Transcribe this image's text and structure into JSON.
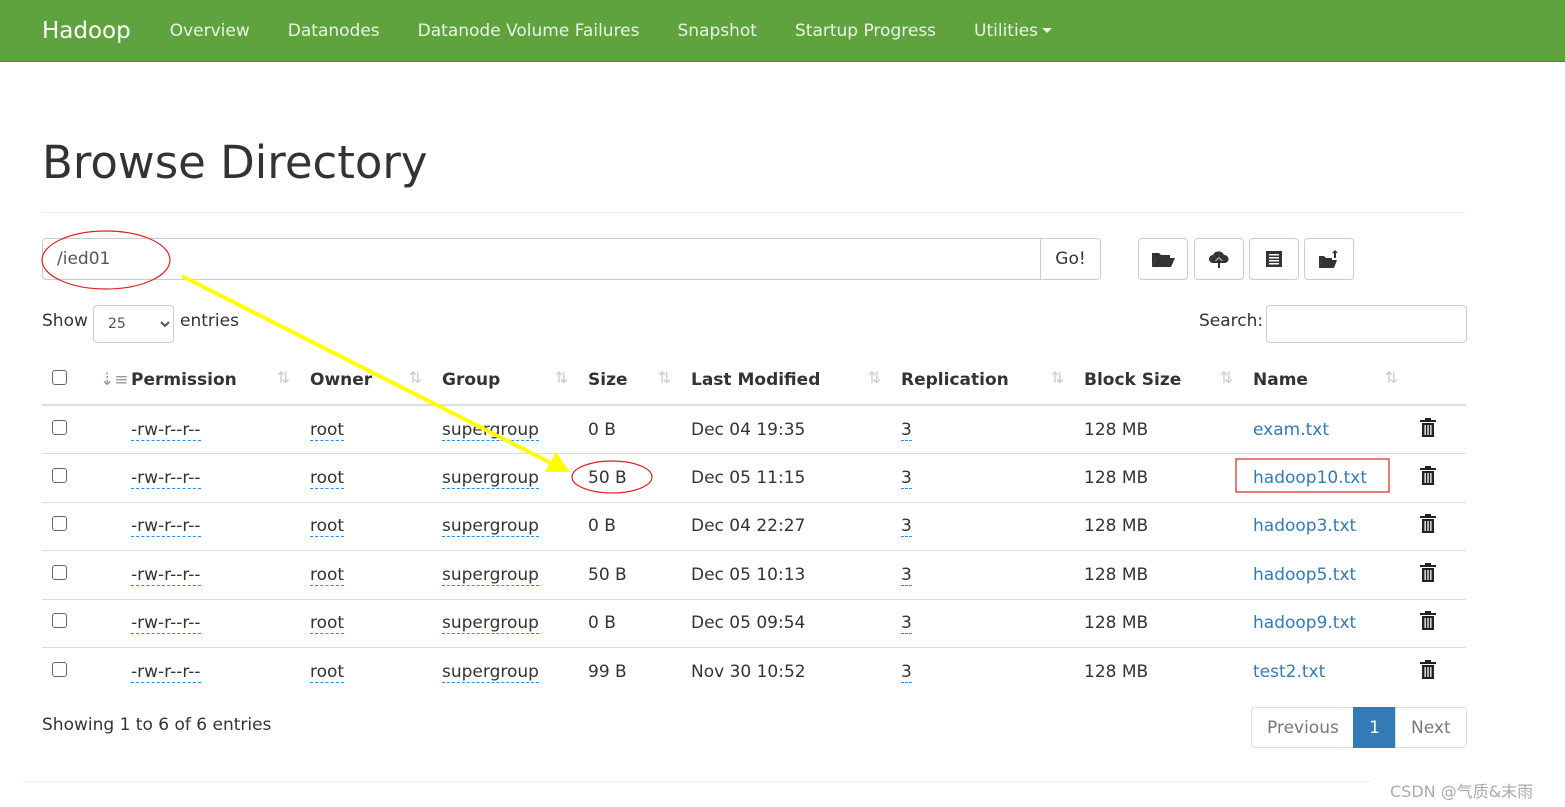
{
  "nav": {
    "brand": "Hadoop",
    "items": [
      "Overview",
      "Datanodes",
      "Datanode Volume Failures",
      "Snapshot",
      "Startup Progress",
      "Utilities"
    ]
  },
  "title": "Browse Directory",
  "path": {
    "value": "/ied01",
    "go": "Go!"
  },
  "toolbar_icons": [
    "folder-open-icon",
    "cloud-upload-icon",
    "list-icon",
    "folder-up-icon"
  ],
  "show": {
    "label": "Show",
    "value": "25",
    "suffix": "entries"
  },
  "search": {
    "label": "Search:",
    "value": ""
  },
  "columns": [
    "Permission",
    "Owner",
    "Group",
    "Size",
    "Last Modified",
    "Replication",
    "Block Size",
    "Name"
  ],
  "rows": [
    {
      "permission": "-rw-r--r--",
      "owner": "root",
      "group": "supergroup",
      "size": "0 B",
      "modified": "Dec 04 19:35",
      "replication": "3",
      "block": "128 MB",
      "name": "exam.txt"
    },
    {
      "permission": "-rw-r--r--",
      "owner": "root",
      "group": "supergroup",
      "size": "50 B",
      "modified": "Dec 05 11:15",
      "replication": "3",
      "block": "128 MB",
      "name": "hadoop10.txt"
    },
    {
      "permission": "-rw-r--r--",
      "owner": "root",
      "group": "supergroup",
      "size": "0 B",
      "modified": "Dec 04 22:27",
      "replication": "3",
      "block": "128 MB",
      "name": "hadoop3.txt"
    },
    {
      "permission": "-rw-r--r--",
      "owner": "root",
      "group": "supergroup",
      "size": "50 B",
      "modified": "Dec 05 10:13",
      "replication": "3",
      "block": "128 MB",
      "name": "hadoop5.txt"
    },
    {
      "permission": "-rw-r--r--",
      "owner": "root",
      "group": "supergroup",
      "size": "0 B",
      "modified": "Dec 05 09:54",
      "replication": "3",
      "block": "128 MB",
      "name": "hadoop9.txt"
    },
    {
      "permission": "-rw-r--r--",
      "owner": "root",
      "group": "supergroup",
      "size": "99 B",
      "modified": "Nov 30 10:52",
      "replication": "3",
      "block": "128 MB",
      "name": "test2.txt"
    }
  ],
  "footer": "Showing 1 to 6 of 6 entries",
  "pagination": {
    "prev": "Previous",
    "page": "1",
    "next": "Next"
  },
  "watermark": "CSDN @气质&末雨",
  "colors": {
    "navbar": "#5fa33e",
    "link": "#337ab7",
    "active_page": "#337ab7",
    "annotation_red": "#e02020",
    "annotation_arrow": "#ffff00"
  }
}
